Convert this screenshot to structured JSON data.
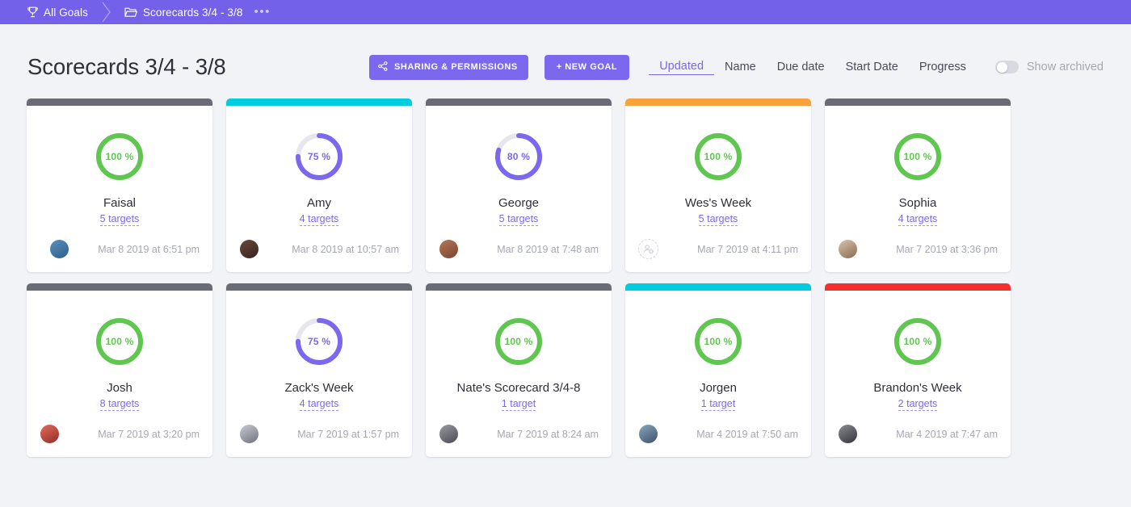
{
  "breadcrumb": {
    "root_label": "All Goals",
    "root_icon": "trophy-icon",
    "folder_label": "Scorecards 3/4 - 3/8",
    "folder_icon": "folder-icon",
    "overflow_label": "•••"
  },
  "header": {
    "title": "Scorecards 3/4 - 3/8",
    "share_button": "SHARING & PERMISSIONS",
    "share_icon": "share-icon",
    "new_goal_button": "+ NEW GOAL",
    "sorts": [
      {
        "label": "Updated",
        "active": true
      },
      {
        "label": "Name",
        "active": false
      },
      {
        "label": "Due date",
        "active": false
      },
      {
        "label": "Start Date",
        "active": false
      },
      {
        "label": "Progress",
        "active": false
      }
    ],
    "show_archived_label": "Show archived",
    "show_archived_on": false
  },
  "colors": {
    "brand_purple": "#7b68ee",
    "breadcrumb_purple": "#7361ea",
    "green": "#5fc74f",
    "gray_bar": "#6b6b78",
    "cyan_bar": "#00cce0",
    "orange_bar": "#f9a13a",
    "red_bar": "#f42f2f",
    "ring_track": "#e6e6ec",
    "page_bg": "#f2f3f7"
  },
  "cards": [
    {
      "name": "Faisal",
      "percent": 100,
      "percent_label": "100 %",
      "targets_label": "5 targets",
      "date": "Mar 8 2019 at 6:51 pm",
      "bar_color": "#6b6b78",
      "ring_color": "#5fc74f",
      "avatar_type": "photo",
      "avatar_colors": [
        "#5a8fbe",
        "#2e5f8a"
      ],
      "extra_avatar": true
    },
    {
      "name": "Amy",
      "percent": 75,
      "percent_label": "75 %",
      "targets_label": "4 targets",
      "date": "Mar 8 2019 at 10:57 am",
      "bar_color": "#00cce0",
      "ring_color": "#7b68ee",
      "avatar_type": "photo",
      "avatar_colors": [
        "#6b4a3a",
        "#34221c"
      ],
      "extra_avatar": false
    },
    {
      "name": "George",
      "percent": 80,
      "percent_label": "80 %",
      "targets_label": "5 targets",
      "date": "Mar 8 2019 at 7:48 am",
      "bar_color": "#6b6b78",
      "ring_color": "#7b68ee",
      "avatar_type": "photo",
      "avatar_colors": [
        "#b4775a",
        "#7a4430"
      ],
      "extra_avatar": false
    },
    {
      "name": "Wes's Week",
      "percent": 100,
      "percent_label": "100 %",
      "targets_label": "5 targets",
      "date": "Mar 7 2019 at 4:11 pm",
      "bar_color": "#f9a13a",
      "ring_color": "#5fc74f",
      "avatar_type": "add",
      "avatar_colors": [],
      "extra_avatar": false
    },
    {
      "name": "Sophia",
      "percent": 100,
      "percent_label": "100 %",
      "targets_label": "4 targets",
      "date": "Mar 7 2019 at 3:36 pm",
      "bar_color": "#6b6b78",
      "ring_color": "#5fc74f",
      "avatar_type": "photo",
      "avatar_colors": [
        "#d9c4ad",
        "#8a6a52"
      ],
      "extra_avatar": false
    },
    {
      "name": "Josh",
      "percent": 100,
      "percent_label": "100 %",
      "targets_label": "8 targets",
      "date": "Mar 7 2019 at 3:20 pm",
      "bar_color": "#6b6b78",
      "ring_color": "#5fc74f",
      "avatar_type": "photo",
      "avatar_colors": [
        "#e86a5a",
        "#8c2f28"
      ],
      "extra_avatar": false
    },
    {
      "name": "Zack's Week",
      "percent": 75,
      "percent_label": "75 %",
      "targets_label": "4 targets",
      "date": "Mar 7 2019 at 1:57 pm",
      "bar_color": "#6b6b78",
      "ring_color": "#7b68ee",
      "avatar_type": "photo",
      "avatar_colors": [
        "#c9cbd2",
        "#6e737e"
      ],
      "extra_avatar": false
    },
    {
      "name": "Nate's Scorecard 3/4-8",
      "percent": 100,
      "percent_label": "100 %",
      "targets_label": "1 target",
      "date": "Mar 7 2019 at 8:24 am",
      "bar_color": "#6b6b78",
      "ring_color": "#5fc74f",
      "avatar_type": "photo",
      "avatar_colors": [
        "#9a9aa2",
        "#4a4a52"
      ],
      "extra_avatar": false
    },
    {
      "name": "Jorgen",
      "percent": 100,
      "percent_label": "100 %",
      "targets_label": "1 target",
      "date": "Mar 4 2019 at 7:50 am",
      "bar_color": "#00cce0",
      "ring_color": "#5fc74f",
      "avatar_type": "photo",
      "avatar_colors": [
        "#8aa6c0",
        "#3d5268"
      ],
      "extra_avatar": false
    },
    {
      "name": "Brandon's Week",
      "percent": 100,
      "percent_label": "100 %",
      "targets_label": "2 targets",
      "date": "Mar 4 2019 at 7:47 am",
      "bar_color": "#f42f2f",
      "ring_color": "#5fc74f",
      "avatar_type": "photo",
      "avatar_colors": [
        "#8c8c94",
        "#33333b"
      ],
      "extra_avatar": false
    }
  ]
}
